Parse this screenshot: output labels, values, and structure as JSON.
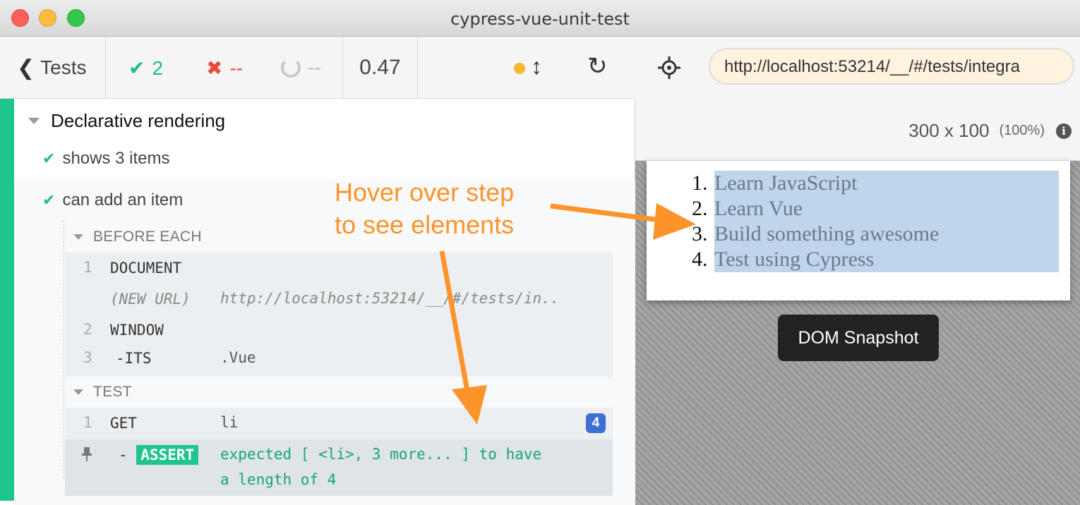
{
  "window": {
    "title": "cypress-vue-unit-test"
  },
  "toolbar": {
    "back_label": "Tests",
    "passed": "2",
    "failed": "--",
    "pending": "--",
    "duration": "0.47"
  },
  "suite": {
    "title": "Declarative rendering",
    "tests": [
      {
        "title": "shows 3 items",
        "state": "passed"
      },
      {
        "title": "can add an item",
        "state": "passed"
      }
    ]
  },
  "before_each": {
    "label": "BEFORE EACH",
    "commands": [
      {
        "num": "1",
        "name": "DOCUMENT",
        "message": ""
      },
      {
        "num": "",
        "name": "(NEW URL)",
        "message": "http://localhost:53214/__/#/tests/in.."
      },
      {
        "num": "2",
        "name": "WINDOW",
        "message": ""
      },
      {
        "num": "3",
        "name": "-ITS",
        "message": ".Vue"
      }
    ]
  },
  "test_hook": {
    "label": "TEST",
    "commands": [
      {
        "num": "1",
        "name": "GET",
        "message": "li",
        "badge": "4"
      },
      {
        "num": "",
        "name": "ASSERT",
        "message_line1": "expected [ <li>, 3 more... ] to have",
        "message_line2": "a length of 4"
      }
    ]
  },
  "aut": {
    "url": "http://localhost:53214/__/#/tests/integra",
    "viewport": "300 x 100",
    "scale": "(100%)",
    "list": [
      {
        "n": "1.",
        "text": "Learn JavaScript"
      },
      {
        "n": "2.",
        "text": "Learn Vue"
      },
      {
        "n": "3.",
        "text": "Build something awesome"
      },
      {
        "n": "4.",
        "text": "Test using Cypress"
      }
    ],
    "snapshot_label": "DOM Snapshot"
  },
  "annotation": {
    "line1": "Hover over step",
    "line2": "to see elements",
    "color": "#fc9429"
  },
  "colors": {
    "pass": "#1ebe87",
    "fail": "#e94a3a",
    "accent": "#1fc58d",
    "badge": "#3c6fd1"
  }
}
